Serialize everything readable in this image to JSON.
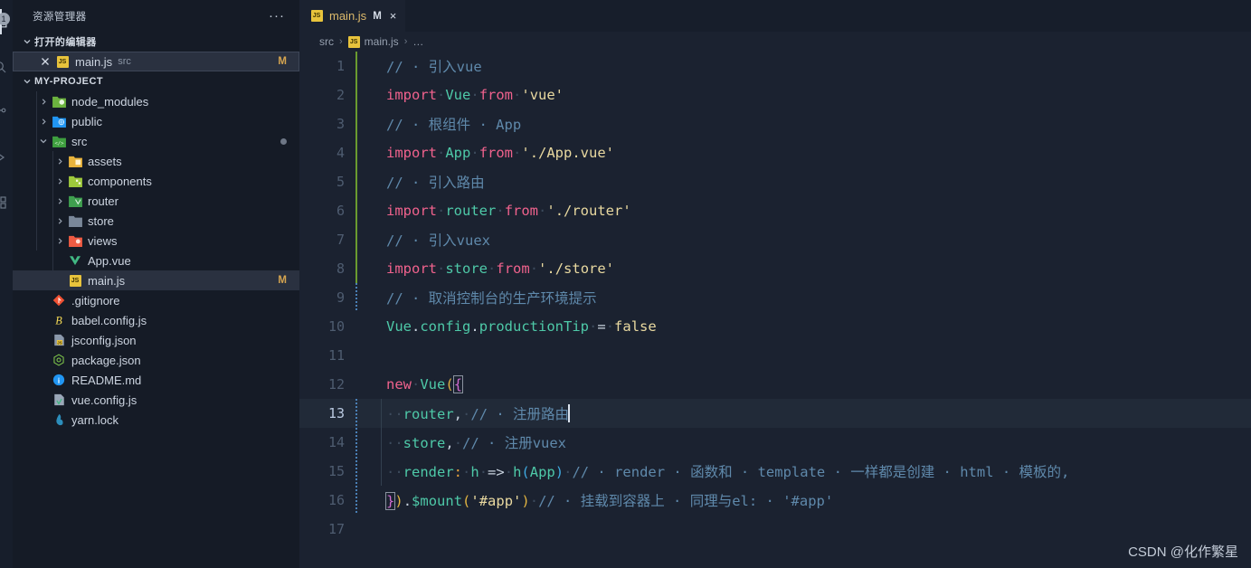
{
  "activity_bar": {
    "items": [
      {
        "name": "explorer",
        "icon": "files-icon",
        "active": true
      },
      {
        "name": "search",
        "icon": "search-icon",
        "active": false
      },
      {
        "name": "source-control",
        "icon": "source-control-icon",
        "active": false,
        "badge": "1"
      },
      {
        "name": "run-and-debug",
        "icon": "debug-icon",
        "active": false
      },
      {
        "name": "extensions",
        "icon": "extensions-icon",
        "active": false
      }
    ]
  },
  "sidebar": {
    "header_title": "资源管理器",
    "more_actions": "···",
    "open_editors": {
      "section_label": "打开的编辑器",
      "items": [
        {
          "icon": "js-file-icon",
          "label": "main.js",
          "sublabel": "src",
          "badge": "M",
          "selected": true
        }
      ]
    },
    "project": {
      "section_label": "MY-PROJECT",
      "items": [
        {
          "label": "node_modules",
          "icon": "folder-node-icon",
          "depth": 1,
          "arrow": "collapsed",
          "type": "folder"
        },
        {
          "label": "public",
          "icon": "folder-public-icon",
          "depth": 1,
          "arrow": "collapsed",
          "type": "folder"
        },
        {
          "label": "src",
          "icon": "folder-src-icon",
          "depth": 1,
          "arrow": "expanded",
          "type": "folder",
          "dirty_dot": true
        },
        {
          "label": "assets",
          "icon": "folder-assets-icon",
          "depth": 2,
          "arrow": "collapsed",
          "type": "folder"
        },
        {
          "label": "components",
          "icon": "folder-components-icon",
          "depth": 2,
          "arrow": "collapsed",
          "type": "folder"
        },
        {
          "label": "router",
          "icon": "folder-router-icon",
          "depth": 2,
          "arrow": "collapsed",
          "type": "folder"
        },
        {
          "label": "store",
          "icon": "folder-store-icon",
          "depth": 2,
          "arrow": "collapsed",
          "type": "folder"
        },
        {
          "label": "views",
          "icon": "folder-views-icon",
          "depth": 2,
          "arrow": "collapsed",
          "type": "folder"
        },
        {
          "label": "App.vue",
          "icon": "vue-file-icon",
          "depth": 2,
          "arrow": "none",
          "type": "file"
        },
        {
          "label": "main.js",
          "icon": "js-file-icon",
          "depth": 2,
          "arrow": "none",
          "type": "file",
          "badge": "M",
          "selected": true
        },
        {
          "label": ".gitignore",
          "icon": "git-file-icon",
          "depth": 1,
          "arrow": "none",
          "type": "file"
        },
        {
          "label": "babel.config.js",
          "icon": "babel-file-icon",
          "depth": 1,
          "arrow": "none",
          "type": "file"
        },
        {
          "label": "jsconfig.json",
          "icon": "jsconfig-file-icon",
          "depth": 1,
          "arrow": "none",
          "type": "file"
        },
        {
          "label": "package.json",
          "icon": "npm-file-icon",
          "depth": 1,
          "arrow": "none",
          "type": "file"
        },
        {
          "label": "README.md",
          "icon": "readme-file-icon",
          "depth": 1,
          "arrow": "none",
          "type": "file"
        },
        {
          "label": "vue.config.js",
          "icon": "vueconfig-file-icon",
          "depth": 1,
          "arrow": "none",
          "type": "file"
        },
        {
          "label": "yarn.lock",
          "icon": "yarn-file-icon",
          "depth": 1,
          "arrow": "none",
          "type": "file"
        }
      ]
    }
  },
  "editor": {
    "tab": {
      "icon": "js-file-icon",
      "label": "main.js",
      "modified_badge": "M",
      "close_label": "×"
    },
    "breadcrumb": {
      "part1": "src",
      "sep1": "›",
      "part2": "main.js",
      "sep2": "›",
      "part3": "…"
    },
    "line_numbers": [
      "1",
      "2",
      "3",
      "4",
      "5",
      "6",
      "7",
      "8",
      "9",
      "10",
      "11",
      "12",
      "13",
      "14",
      "15",
      "16",
      "17"
    ],
    "active_line": 13,
    "lines": [
      {
        "n": "1",
        "text": "// 引入vue"
      },
      {
        "n": "2",
        "text": "import Vue from 'vue'"
      },
      {
        "n": "3",
        "text": "// 根组件 App"
      },
      {
        "n": "4",
        "text": "import App from './App.vue'"
      },
      {
        "n": "5",
        "text": "// 引入路由"
      },
      {
        "n": "6",
        "text": "import router from './router'"
      },
      {
        "n": "7",
        "text": "// 引入vuex"
      },
      {
        "n": "8",
        "text": "import store from './store'"
      },
      {
        "n": "9",
        "text": "// 取消控制台的生产环境提示"
      },
      {
        "n": "10",
        "text": "Vue.config.productionTip = false"
      },
      {
        "n": "11",
        "text": ""
      },
      {
        "n": "12",
        "text": "new Vue({"
      },
      {
        "n": "13",
        "text": "  router, // 注册路由"
      },
      {
        "n": "14",
        "text": "  store, // 注册vuex"
      },
      {
        "n": "15",
        "text": "  render: h => h(App) // render 函数和 template 一样都是创建 html 模板的,"
      },
      {
        "n": "16",
        "text": "}).$mount('#app') // 挂载到容器上 同理与el: '#app'"
      },
      {
        "n": "17",
        "text": ""
      }
    ],
    "tokens": {
      "l1_comment": "// · 引入vue",
      "l2_import": "import",
      "l2_vue": "Vue",
      "l2_from": "from",
      "l2_str": "'vue'",
      "l3_comment": "// · 根组件 · App",
      "l4_import": "import",
      "l4_app": "App",
      "l4_from": "from",
      "l4_str": "'./App.vue'",
      "l5_comment": "// · 引入路由",
      "l6_import": "import",
      "l6_router": "router",
      "l6_from": "from",
      "l6_str": "'./router'",
      "l7_comment": "// · 引入vuex",
      "l8_import": "import",
      "l8_store": "store",
      "l8_from": "from",
      "l8_str": "'./store'",
      "l9_comment": "// · 取消控制台的生产环境提示",
      "l10_vue": "Vue",
      "l10_dot1": ".",
      "l10_config": "config",
      "l10_dot2": ".",
      "l10_prop": "productionTip",
      "l10_eq": "=",
      "l10_false": "false",
      "l12_new": "new",
      "l12_vue": "Vue",
      "l12_paren": "(",
      "l12_brace": "{",
      "l13_router": "router",
      "l13_comma": ",",
      "l13_comment": "// · 注册路由",
      "l14_store": "store",
      "l14_comma": ",",
      "l14_comment": "// · 注册vuex",
      "l15_render": "render",
      "l15_colon": ":",
      "l15_h": "h",
      "l15_arrow": "=>",
      "l15_h2": "h",
      "l15_p1": "(",
      "l15_app": "App",
      "l15_p2": ")",
      "l15_comment": "// · render · 函数和 · template · 一样都是创建 · html · 模板的,",
      "l16_brace": "}",
      "l16_paren": ")",
      "l16_dot": ".",
      "l16_mount": "$mount",
      "l16_p1": "(",
      "l16_str": "'#app'",
      "l16_p2": ")",
      "l16_comment": "// · 挂载到容器上 · 同理与el: · '#app'"
    }
  },
  "watermark": "CSDN @化作繁星",
  "colors": {
    "editor_background": "#1b2230",
    "sidebar_background": "#151b26",
    "activitybar_background": "#171e2b",
    "tabbar_background": "#171e2b",
    "active_line_background": "#212a38",
    "selection_background": "#2a3140",
    "comment": "#5f89ab",
    "keyword": "#f0628d",
    "variable": "#4ec9a8",
    "string": "#e9d9a0",
    "modified_badge": "#d6a550",
    "indent_guide_green": "#6a9b2f",
    "indent_guide_active": "#4a7fb5"
  }
}
